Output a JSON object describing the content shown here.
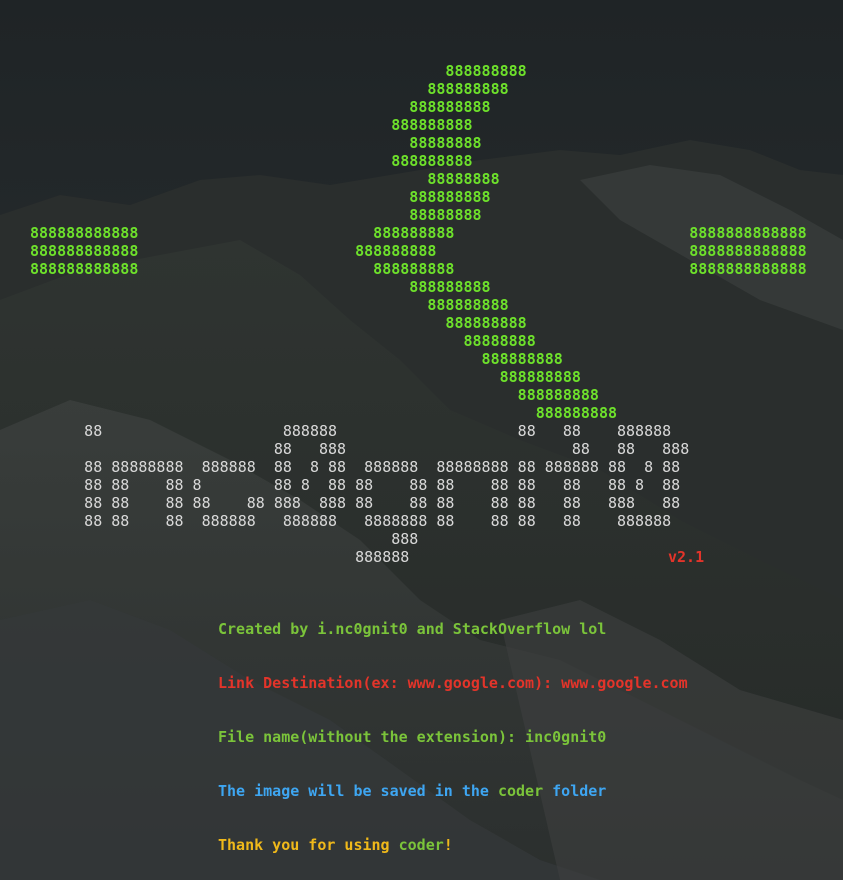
{
  "colors": {
    "banner_green": "#6ee22b",
    "logo_gray": "#d9d9d9",
    "credit_green": "#7bc43a",
    "error_red": "#e3342a",
    "info_blue": "#3ea6f2",
    "highlight_green": "#7bc43a",
    "thanks_yellow": "#f0b91a"
  },
  "banner": {
    "icon": "cursor-arrow-ascii-art",
    "art": "                                              888888888\n                                            888888888\n                                          888888888\n                                        888888888\n                                          88888888\n                                        888888888\n                                            88888888\n                                          888888888\n                                          88888888\n888888888888                          888888888                          8888888888888\n888888888888                        888888888                            8888888888888\n888888888888                          888888888                          8888888888888\n                                          888888888\n                                            888888888\n                                              888888888\n                                                88888888\n                                                  888888888\n                                                    888888888\n                                                      888888888\n                                                        888888888"
  },
  "logo": {
    "art": "      88                    888888                    88   88    888888\n                           88   888                         88   88   888\n      88 88888888  888888  88  8 88  888888  88888888 88 888888 88  8 88\n      88 88    88 8        88 8  88 88    88 88    88 88   88   88 8  88\n      88 88    88 88    88 888  888 88    88 88    88 88   88   888   88\n      88 88    88  888888   888888   8888888 88    88 88   88    888888\n                                        888\n                                    888888",
    "version": "v2.1"
  },
  "output": {
    "credit": "Created by i.nc0gnit0 and StackOverflow lol",
    "link_prompt": "Link Destination(ex: www.google.com): www.google.com",
    "filename_prompt": "File name(without the extension): inc0gnit0",
    "saved_prefix": "The image will be saved in the ",
    "saved_folder": "coder",
    "saved_suffix": " folder",
    "thanks_prefix": "Thank you for using ",
    "thanks_app": "coder",
    "thanks_suffix": "!"
  }
}
